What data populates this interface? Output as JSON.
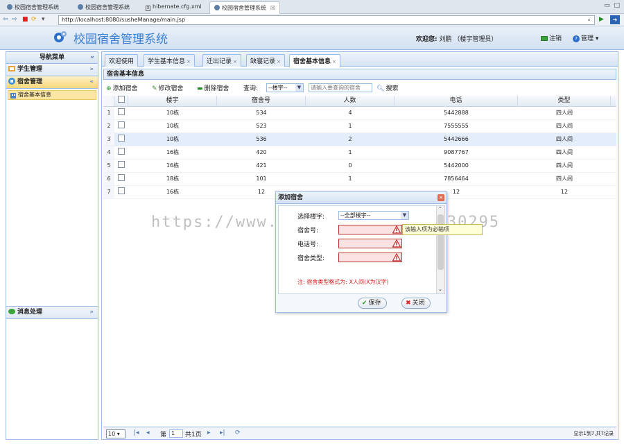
{
  "browser": {
    "tabs": [
      {
        "label": "校园宿舍管理系统",
        "active": false
      },
      {
        "label": "校园宿舍管理系统",
        "active": false
      },
      {
        "label": "hibernate.cfg.xml",
        "active": false
      },
      {
        "label": "校园宿舍管理系统",
        "active": true
      }
    ],
    "url": "http://localhost:8080/susheManage/main.jsp"
  },
  "header": {
    "title": "校园宿舍管理系统",
    "welcome_label": "欢迎您:",
    "welcome_user": "刘鹏 （楼宇管理员）",
    "logout_label": "注销",
    "manage_label": "管理"
  },
  "sidebar": {
    "title": "导航菜单",
    "sections": [
      {
        "label": "学生管理"
      },
      {
        "label": "宿舍管理",
        "active": true,
        "items": [
          {
            "label": "宿舍基本信息"
          }
        ]
      },
      {
        "label": "消息处理"
      }
    ]
  },
  "main": {
    "tabs": [
      {
        "label": "欢迎使用",
        "closable": false
      },
      {
        "label": "学生基本信息",
        "closable": true
      },
      {
        "label": "迁出记录",
        "closable": true
      },
      {
        "label": "缺寝记录",
        "closable": true
      },
      {
        "label": "宿舍基本信息",
        "closable": true,
        "active": true
      }
    ],
    "panel_title": "宿舍基本信息",
    "toolbar": {
      "add_label": "添加宿舍",
      "edit_label": "修改宿舍",
      "delete_label": "删除宿舍",
      "query_label": "查询:",
      "building_select_value": "--楼宇--",
      "search_placeholder": "请输入要查询的宿舍",
      "search_label": "搜索"
    },
    "grid": {
      "columns": [
        "楼宇",
        "宿舍号",
        "人数",
        "电话",
        "类型"
      ],
      "rows": [
        {
          "n": "1",
          "building": "10栋",
          "room": "534",
          "count": "4",
          "phone": "5442888",
          "type": "四人间"
        },
        {
          "n": "2",
          "building": "10栋",
          "room": "523",
          "count": "1",
          "phone": "7555555",
          "type": "四人间"
        },
        {
          "n": "3",
          "building": "10栋",
          "room": "536",
          "count": "2",
          "phone": "5442666",
          "type": "四人间",
          "selected": true
        },
        {
          "n": "4",
          "building": "16栋",
          "room": "420",
          "count": "1",
          "phone": "9087767",
          "type": "四人间"
        },
        {
          "n": "5",
          "building": "16栋",
          "room": "421",
          "count": "0",
          "phone": "5442000",
          "type": "四人间"
        },
        {
          "n": "6",
          "building": "18栋",
          "room": "101",
          "count": "1",
          "phone": "7856464",
          "type": "四人间"
        },
        {
          "n": "7",
          "building": "16栋",
          "room": "12",
          "count": "",
          "phone": "12",
          "type": "12"
        }
      ]
    },
    "pager": {
      "page_size": "10",
      "page_prefix": "第",
      "page_value": "1",
      "page_total": "共1页",
      "info": "显示1到7,共7记录"
    }
  },
  "dialog": {
    "title": "添加宿舍",
    "fields": [
      {
        "label": "选择楼宇:",
        "value": "--全部楼宇--"
      },
      {
        "label": "宿舍号:"
      },
      {
        "label": "电话号:"
      },
      {
        "label": "宿舍类型:"
      }
    ],
    "tooltip": "该输入项为必输项",
    "note": "注: 宿舍类型格式为: X人间(X为汉字)",
    "save_label": "保存",
    "close_label": "关闭"
  },
  "watermark": "https://www.huzhan.com/ishop30295",
  "colors": {
    "accent": "#3b7fd2",
    "border": "#99bbe8",
    "error": "#d21b1b",
    "selected_row": "#e3edfb"
  }
}
